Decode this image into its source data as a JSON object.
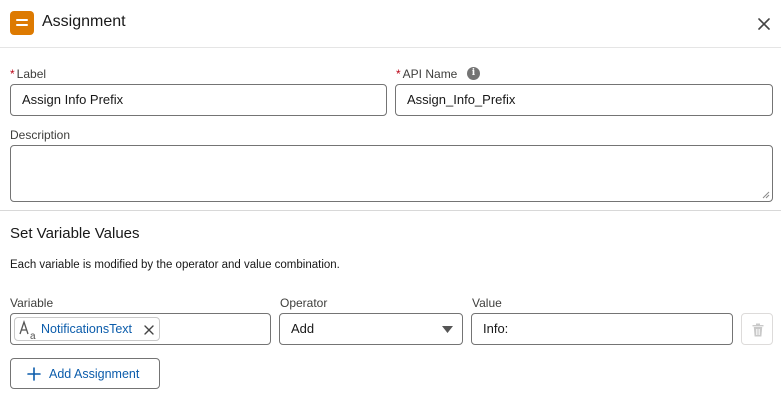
{
  "header": {
    "title": "Assignment",
    "icon": "assignment-icon",
    "icon_color": "#dd7a01"
  },
  "form": {
    "label": {
      "required_mark": "*",
      "caption": "Label",
      "value": "Assign Info Prefix"
    },
    "api_name": {
      "required_mark": "*",
      "caption": "API Name",
      "value": "Assign_Info_Prefix",
      "info_glyph": "i"
    },
    "description": {
      "caption": "Description",
      "value": ""
    }
  },
  "section": {
    "title": "Set Variable Values",
    "help": "Each variable is modified by the operator and value combination."
  },
  "assignment_row": {
    "variable_caption": "Variable",
    "variable_pill": "NotificationsText",
    "variable_type_icon": "text-type-icon",
    "operator_caption": "Operator",
    "operator_value": "Add",
    "value_caption": "Value",
    "value": "Info:"
  },
  "actions": {
    "add_assignment": "Add Assignment"
  },
  "colors": {
    "link_blue": "#0b5cab",
    "required_red": "#ba0517",
    "border": "#747474"
  }
}
